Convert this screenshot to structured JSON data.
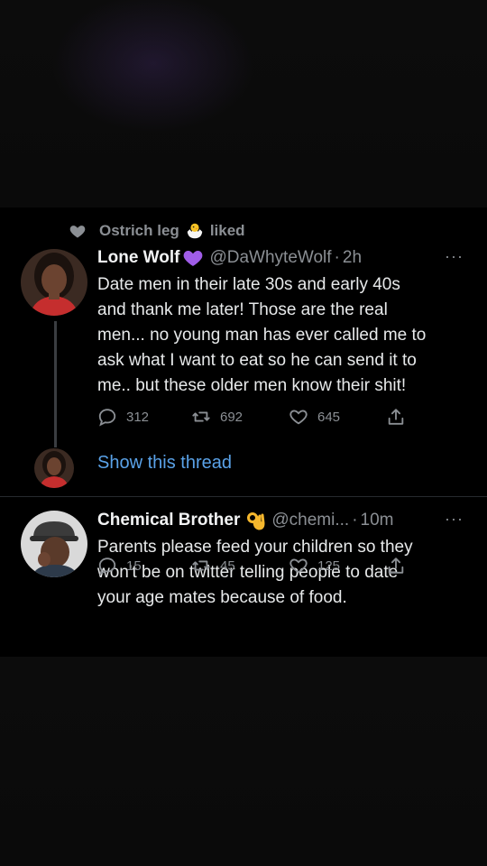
{
  "colors": {
    "background": "#000000",
    "text": "#e7e9ea",
    "secondary": "#8b8f94",
    "link": "#5aa2e8",
    "heart_purple": "#a05de8"
  },
  "social_context": {
    "icon": "heart-icon",
    "user": "Ostrich leg",
    "emoji": "baby-chick-emoji",
    "action": "liked"
  },
  "tweets": [
    {
      "name": "Lone Wolf",
      "name_emoji": "purple-heart-emoji",
      "handle": "@DaWhyteWolf",
      "separator": "·",
      "time": "2h",
      "more": "···",
      "text": "Date men in their late 30s and early 40s\nand thank me later! Those are the real\nmen... no young man has ever called me to\nask what I want to eat so he can send it to\nme.. but these older men know their shit!",
      "replies": "312",
      "retweets": "692",
      "likes": "645",
      "show_thread": "Show this thread"
    },
    {
      "name": "Chemical Brother",
      "name_emoji": "ok-hand-emoji",
      "handle": "@chemi...",
      "separator": "·",
      "time": "10m",
      "more": "···",
      "text": "Parents please feed your children so they\nwon't be on twitter telling people to date\nyour age mates because of food.",
      "replies": "15",
      "retweets": "45",
      "likes": "125"
    }
  ]
}
